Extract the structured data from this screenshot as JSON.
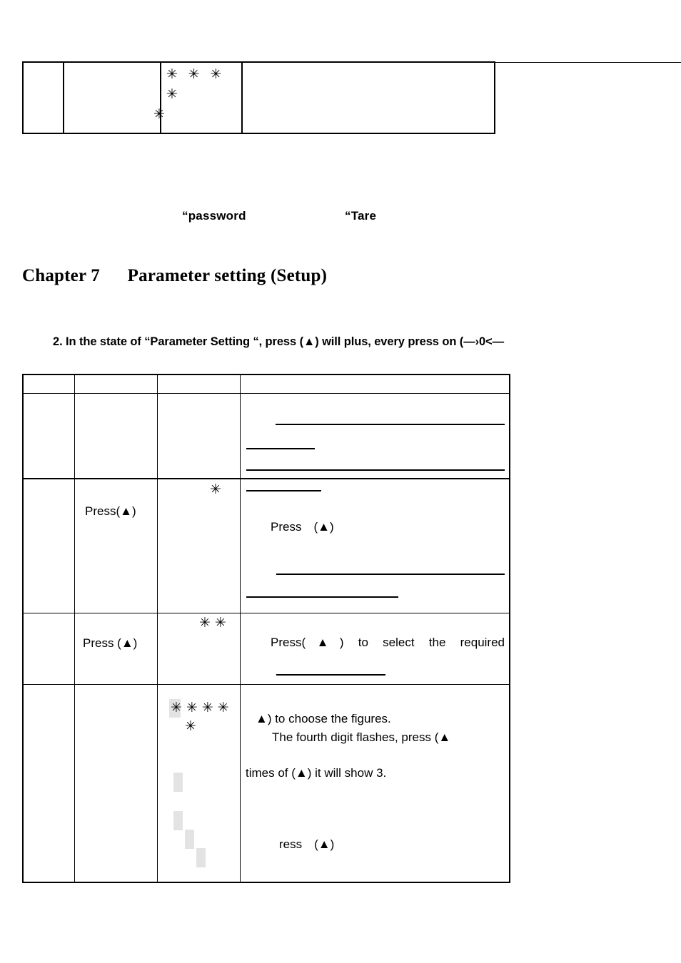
{
  "document": {
    "chapter_heading": "Chapter 7      Parameter setting (Setup)",
    "quote_password": "“password",
    "quote_tare": "“Tare",
    "instruction": "2. In the state of “Parameter Setting “, press (▲) will plus, every press on (—›0<—"
  },
  "top_table": {
    "stars_line1": "✳ ✳ ✳ ✳",
    "stars_line2": "✳"
  },
  "main_table": {
    "columns": [
      "",
      "",
      "",
      ""
    ],
    "rows": [
      {
        "name": "header-row",
        "col1": "",
        "col2": "",
        "col3": "",
        "col4": ""
      },
      {
        "name": "row-blank-rules",
        "col1": "",
        "col2": "",
        "col3": "",
        "col4": ""
      },
      {
        "name": "row-press-up-1",
        "col1": "",
        "col2": "Press(▲)",
        "col3_stars": "✳",
        "col4": "Press　(▲)"
      },
      {
        "name": "row-press-up-2",
        "col1": "",
        "col2": "Press (▲)",
        "col3_stars": "✳✳",
        "col4": "Press(▲) to select the required"
      },
      {
        "name": "row-digits",
        "col1": "",
        "col2": "",
        "col3_stars_line1": "✳✳✳✳",
        "col3_stars_line2": "✳",
        "col4_line1": "▲) to choose the figures.",
        "col4_line2": "The fourth digit flashes, press (▲",
        "col4_line3": "times of (▲) it will show 3.",
        "col4_line4": "ress　(▲)"
      }
    ]
  },
  "colors": {
    "ink": "#000000",
    "paper": "#ffffff",
    "highlight": "#e3e3e3"
  }
}
